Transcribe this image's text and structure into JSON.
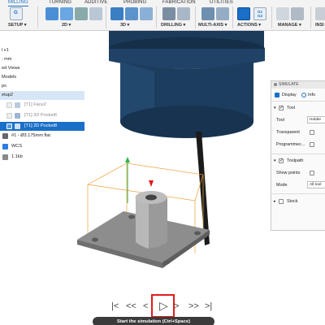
{
  "toolbar": {
    "tabs": [
      "MILLING",
      "TURNING",
      "ADDITIVE",
      "PROBING",
      "FABRICATION",
      "UTILITIES"
    ],
    "active_tab": "MILLING",
    "groups": [
      "SETUP ▾",
      "2D ▾",
      "3D ▾",
      "DRILLING ▾",
      "MULTI-AXIS ▾",
      "ACTIONS ▾",
      "MANAGE ▾",
      "INSI"
    ],
    "g1g2_label": "G1\nG2"
  },
  "browser": {
    "items": [
      {
        "label": "l v1"
      },
      {
        "label": ": mm"
      },
      {
        "label": "ed Views"
      },
      {
        "label": "Models"
      },
      {
        "label": "ps"
      },
      {
        "label": "etup2"
      },
      {
        "label": "[T1] Face2"
      },
      {
        "label": "[T1] 2D Pocket6"
      },
      {
        "label": "[T1] 2D Pocket8"
      },
      {
        "label": "#1 - Ø3.175mm flat"
      },
      {
        "label": "WCS"
      },
      {
        "label": "1.1kb"
      }
    ]
  },
  "simulate_panel": {
    "title": "SIMULATE",
    "tabs": [
      "Display",
      "Info"
    ],
    "tool_section": "Tool",
    "tool_label": "Tool",
    "tool_value": "Holder",
    "transparent_label": "Transparent",
    "programmed_label": "Programmec...",
    "toolpath_section": "Toolpath",
    "show_points_label": "Show points",
    "mode_label": "Mode",
    "mode_value": "All tool",
    "stock_section": "Stock"
  },
  "playback": {
    "tooltip": "Start the simulation (Ctrl+Space)"
  },
  "colors": {
    "accent": "#1a6fc7",
    "tool_body": "#1c3a5a",
    "highlight": "#e01b1b"
  }
}
